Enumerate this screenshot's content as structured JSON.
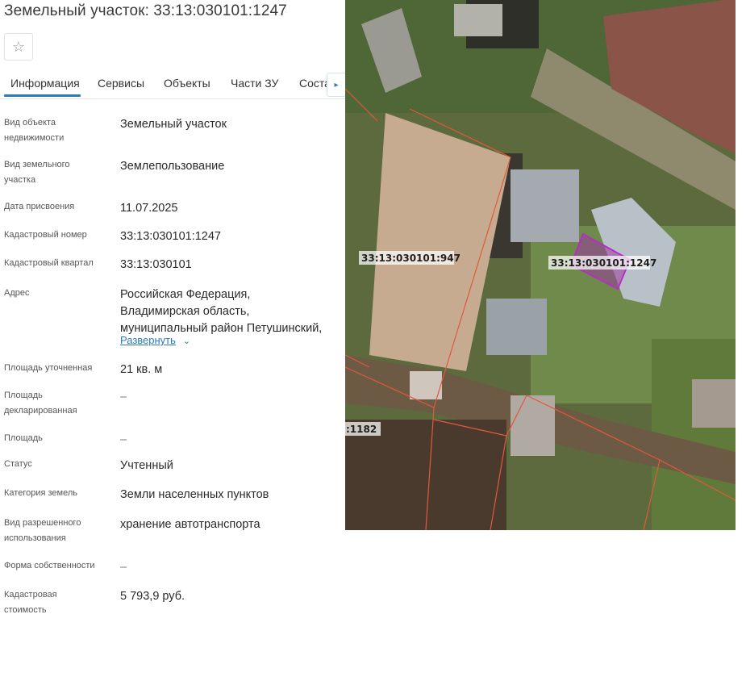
{
  "page": {
    "title": "Земельный участок: 33:13:030101:1247"
  },
  "favorite": {
    "icon": "star-icon",
    "glyph": "☆"
  },
  "tabs": [
    {
      "label": "Информация",
      "active": true
    },
    {
      "label": "Сервисы"
    },
    {
      "label": "Объекты"
    },
    {
      "label": "Части ЗУ"
    },
    {
      "label": "Соста"
    }
  ],
  "tabs_next_icon": {
    "icon": "chevron-right-icon",
    "glyph": "▸"
  },
  "info": {
    "object_type": {
      "label": "Вид объекта недвижимости",
      "value": "Земельный участок"
    },
    "parcel_type": {
      "label": "Вид земельного участка",
      "value": "Землепользование"
    },
    "assign_date": {
      "label": "Дата присвоения",
      "value": "11.07.2025"
    },
    "cadastral_number": {
      "label": "Кадастровый номер",
      "value": "33:13:030101:1247"
    },
    "cadastral_block": {
      "label": "Кадастровый квартал",
      "value": "33:13:030101"
    },
    "address": {
      "label": "Адрес",
      "line1": "Российская Федерация,",
      "line2": "Владимирская область,",
      "line3": "муниципальный район Петушинский,",
      "expand_label": "Развернуть",
      "expand_icon": "chevron-down-icon",
      "expand_glyph": "⌄"
    },
    "area_specified": {
      "label": "Площадь уточненная",
      "value": "21 кв. м"
    },
    "area_declared": {
      "label": "Площадь декларированная",
      "value": "–"
    },
    "area": {
      "label": "Площадь",
      "value": "–"
    },
    "status": {
      "label": "Статус",
      "value": "Учтенный"
    },
    "land_category": {
      "label": "Категория земель",
      "value": "Земли населенных пунктов"
    },
    "permitted_use": {
      "label": "Вид разрешенного использования",
      "value": "хранение автотранспорта"
    },
    "ownership_form": {
      "label": "Форма собственности",
      "value": "–"
    },
    "cadastral_value": {
      "label": "Кадастровая стоимость",
      "value": "5 793,9 руб."
    }
  },
  "map": {
    "labels": {
      "parcel_947": "33:13:030101:947",
      "parcel_1247": "33:13:030101:1247",
      "parcel_1182": ":1182"
    },
    "colors": {
      "boundary": "#e2583a",
      "selected_fill": "#9b3aa3",
      "selected_stroke": "#b52fc4"
    }
  }
}
